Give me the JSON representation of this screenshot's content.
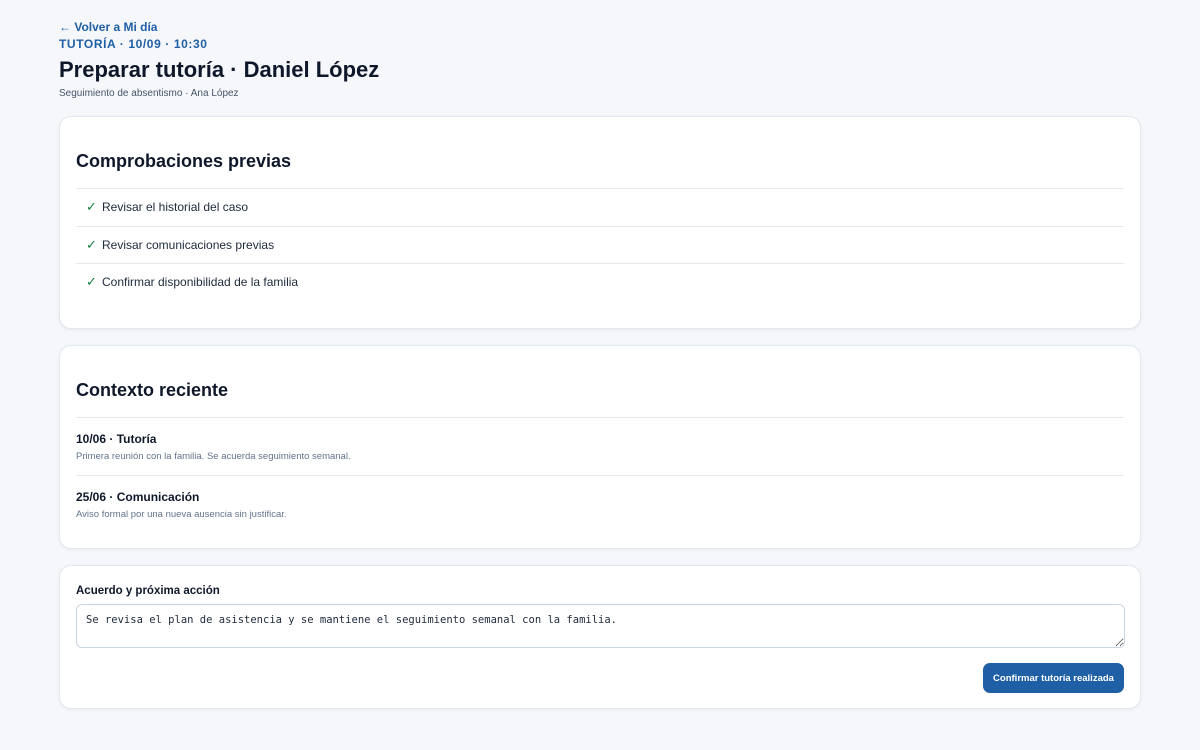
{
  "header": {
    "back_label": "← Volver a Mi día",
    "eyebrow": "TUTORÍA · 10/09 · 10:30",
    "title": "Preparar tutoría · Daniel López",
    "subtitle": "Seguimiento de absentismo · Ana López"
  },
  "checks": {
    "title": "Comprobaciones previas",
    "items": [
      {
        "icon": "✓",
        "label": "Revisar el historial del caso"
      },
      {
        "icon": "✓",
        "label": "Revisar comunicaciones previas"
      },
      {
        "icon": "✓",
        "label": "Confirmar disponibilidad de la familia"
      }
    ]
  },
  "context": {
    "title": "Contexto reciente",
    "entries": [
      {
        "heading": "10/06 · Tutoría",
        "detail": "Primera reunión con la familia. Se acuerda seguimiento semanal."
      },
      {
        "heading": "25/06 · Comunicación",
        "detail": "Aviso formal por una nueva ausencia sin justificar."
      }
    ]
  },
  "agreement": {
    "label": "Acuerdo y próxima acción",
    "value": "Se revisa el plan de asistencia y se mantiene el seguimiento semanal con la familia.",
    "confirm_label": "Confirmar tutoría realizada"
  },
  "colors": {
    "accent": "#1f5fa6",
    "check": "#15803d",
    "background": "#f5f7fa"
  }
}
